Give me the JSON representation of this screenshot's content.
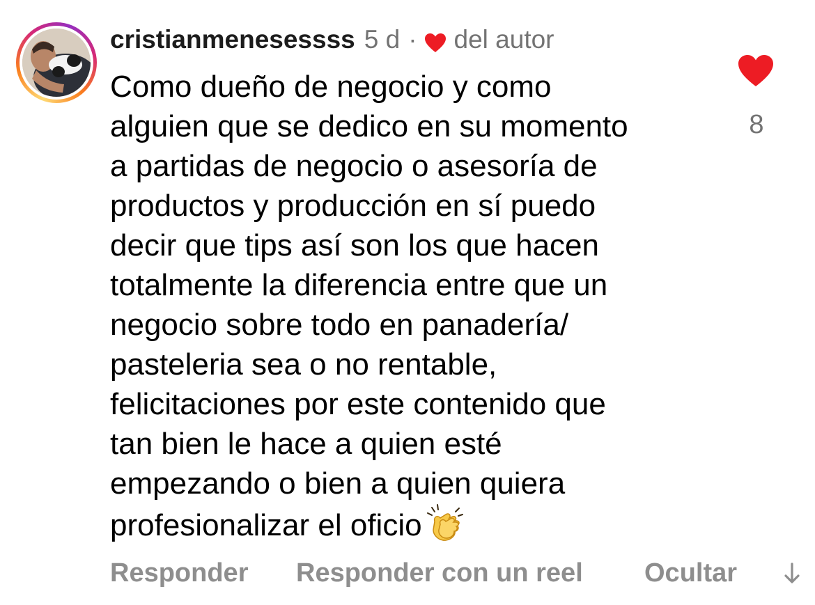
{
  "comment": {
    "username": "cristianmenesessss",
    "time": "5 d",
    "separator": "·",
    "author_like_label": "del autor",
    "author_like_icon": "heart-icon",
    "author_like_color": "#ed1c24",
    "body_lines": [
      "Como dueño de negocio y como",
      "alguien que se dedico en su momento",
      "a partidas de negocio o asesoría de",
      "productos y producción en sí puedo",
      "decir que tips así son los que hacen",
      "totalmente la diferencia entre que un",
      "negocio sobre todo en panadería/",
      "pasteleria sea o no rentable,",
      "felicitaciones por este contenido que",
      "tan bien le hace a quien esté",
      "empezando o bien a quien quiera",
      "profesionalizar el oficio"
    ],
    "emoji": "clapping-hands-emoji",
    "like_icon": "heart-filled-icon",
    "like_color": "#ed1c24",
    "like_count": "8"
  },
  "actions": {
    "reply": "Responder",
    "reply_reel": "Responder con un reel",
    "hide": "Ocultar",
    "more_icon": "arrow-down-icon"
  },
  "colors": {
    "text": "#000000",
    "secondary": "#737373",
    "action": "#8e8e8e",
    "heart": "#ed1c24"
  }
}
